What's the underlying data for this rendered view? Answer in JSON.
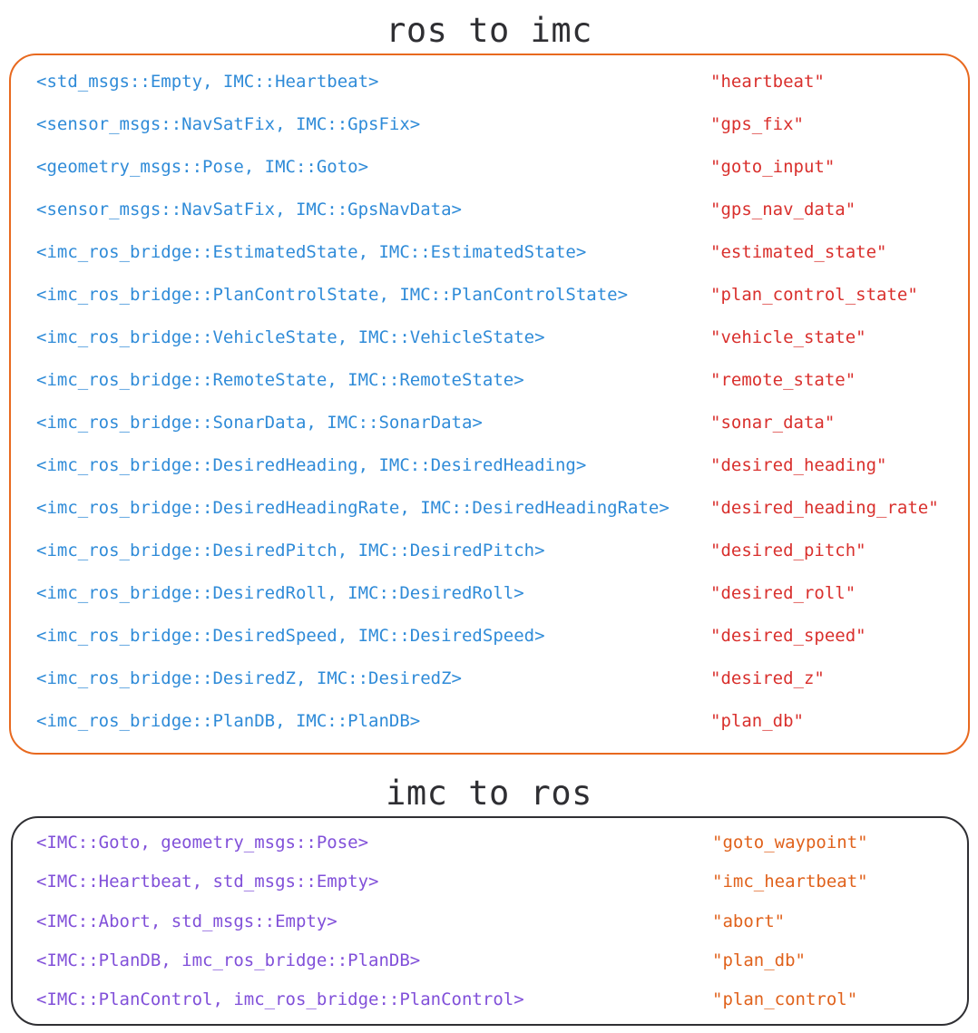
{
  "ros_to_imc": {
    "title": "ros to imc",
    "color_types": "#2f8bd8",
    "color_topics": "#d9302d",
    "color_border": "#e8691f",
    "rows": [
      {
        "type": "<std_msgs::Empty, IMC::Heartbeat>",
        "topic": "\"heartbeat\""
      },
      {
        "type": "<sensor_msgs::NavSatFix, IMC::GpsFix>",
        "topic": "\"gps_fix\""
      },
      {
        "type": "<geometry_msgs::Pose, IMC::Goto>",
        "topic": "\"goto_input\""
      },
      {
        "type": "<sensor_msgs::NavSatFix, IMC::GpsNavData>",
        "topic": "\"gps_nav_data\""
      },
      {
        "type": "<imc_ros_bridge::EstimatedState, IMC::EstimatedState>",
        "topic": "\"estimated_state\""
      },
      {
        "type": "<imc_ros_bridge::PlanControlState, IMC::PlanControlState>",
        "topic": "\"plan_control_state\""
      },
      {
        "type": "<imc_ros_bridge::VehicleState, IMC::VehicleState>",
        "topic": "\"vehicle_state\""
      },
      {
        "type": "<imc_ros_bridge::RemoteState, IMC::RemoteState>",
        "topic": "\"remote_state\""
      },
      {
        "type": "<imc_ros_bridge::SonarData, IMC::SonarData>",
        "topic": "\"sonar_data\""
      },
      {
        "type": "<imc_ros_bridge::DesiredHeading, IMC::DesiredHeading>",
        "topic": "\"desired_heading\""
      },
      {
        "type": "<imc_ros_bridge::DesiredHeadingRate, IMC::DesiredHeadingRate>",
        "topic": "\"desired_heading_rate\""
      },
      {
        "type": "<imc_ros_bridge::DesiredPitch, IMC::DesiredPitch>",
        "topic": "\"desired_pitch\""
      },
      {
        "type": "<imc_ros_bridge::DesiredRoll, IMC::DesiredRoll>",
        "topic": "\"desired_roll\""
      },
      {
        "type": "<imc_ros_bridge::DesiredSpeed, IMC::DesiredSpeed>",
        "topic": "\"desired_speed\""
      },
      {
        "type": "<imc_ros_bridge::DesiredZ, IMC::DesiredZ>",
        "topic": "\"desired_z\""
      },
      {
        "type": "<imc_ros_bridge::PlanDB, IMC::PlanDB>",
        "topic": "\"plan_db\""
      }
    ]
  },
  "imc_to_ros": {
    "title": "imc to ros",
    "color_types": "#8150d9",
    "color_topics": "#e0621c",
    "color_border": "#2f2f33",
    "rows": [
      {
        "type": "<IMC::Goto, geometry_msgs::Pose>",
        "topic": "\"goto_waypoint\""
      },
      {
        "type": "<IMC::Heartbeat, std_msgs::Empty>",
        "topic": "\"imc_heartbeat\""
      },
      {
        "type": "<IMC::Abort, std_msgs::Empty>",
        "topic": "\"abort\""
      },
      {
        "type": "<IMC::PlanDB, imc_ros_bridge::PlanDB>",
        "topic": "\"plan_db\""
      },
      {
        "type": "<IMC::PlanControl, imc_ros_bridge::PlanControl>",
        "topic": "\"plan_control\""
      }
    ]
  }
}
